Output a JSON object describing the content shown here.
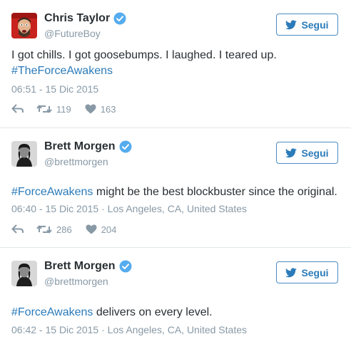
{
  "tweets": [
    {
      "name": "Chris Taylor",
      "handle": "@FutureBoy",
      "follow_label": "Segui",
      "text_plain": "I got chills. I got goosebumps. I laughed. I teared up.",
      "hashtag": "#TheForceAwakens",
      "timestamp": "06:51 - 15 Dic 2015",
      "location": "",
      "retweets": "119",
      "likes": "163",
      "avatar": "red-face-photo"
    },
    {
      "name": "Brett Morgen",
      "handle": "@brettmorgen",
      "follow_label": "Segui",
      "hashtag": "#ForceAwakens",
      "text_rest": " might be the best blockbuster since the original.",
      "timestamp": "06:40 - 15 Dic 2015",
      "separator": " · ",
      "location": "Los Angeles, CA, United States",
      "retweets": "286",
      "likes": "204",
      "avatar": "bw-portrait-photo"
    },
    {
      "name": "Brett Morgen",
      "handle": "@brettmorgen",
      "follow_label": "Segui",
      "hashtag": "#ForceAwakens",
      "text_rest": " delivers on every level.",
      "timestamp": "06:42 - 15 Dic 2015",
      "separator": " · ",
      "location": "Los Angeles, CA, United States",
      "avatar": "bw-portrait-photo"
    }
  ],
  "colors": {
    "link": "#2b7bb9",
    "muted": "#8899a6",
    "verified": "#55acee",
    "divider": "#e1e8ed"
  },
  "icons": [
    "reply-icon",
    "retweet-icon",
    "heart-icon",
    "twitter-bird-icon",
    "verified-badge-icon"
  ]
}
